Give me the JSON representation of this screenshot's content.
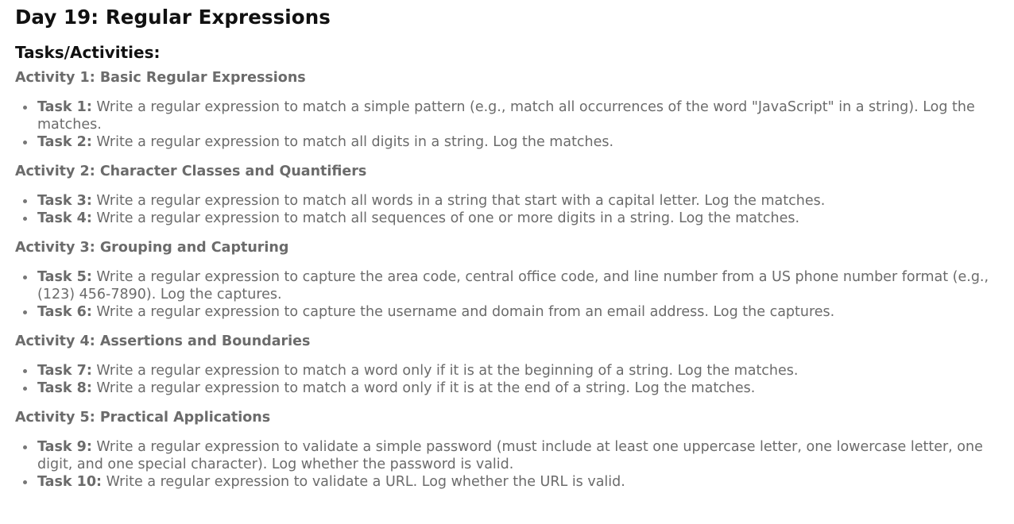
{
  "title": "Day 19: Regular Expressions",
  "subtitle": "Tasks/Activities:",
  "activities": [
    {
      "heading": "Activity 1: Basic Regular Expressions",
      "tasks": [
        {
          "label": "Task 1:",
          "text": " Write a regular expression to match a simple pattern (e.g., match all occurrences of the word \"JavaScript\" in a string). Log the matches."
        },
        {
          "label": "Task 2:",
          "text": " Write a regular expression to match all digits in a string. Log the matches."
        }
      ]
    },
    {
      "heading": "Activity 2: Character Classes and Quantifiers",
      "tasks": [
        {
          "label": "Task 3:",
          "text": " Write a regular expression to match all words in a string that start with a capital letter. Log the matches."
        },
        {
          "label": "Task 4:",
          "text": " Write a regular expression to match all sequences of one or more digits in a string. Log the matches."
        }
      ]
    },
    {
      "heading": "Activity 3: Grouping and Capturing",
      "tasks": [
        {
          "label": "Task 5:",
          "text": " Write a regular expression to capture the area code, central office code, and line number from a US phone number format (e.g., (123) 456-7890). Log the captures."
        },
        {
          "label": "Task 6:",
          "text": " Write a regular expression to capture the username and domain from an email address. Log the captures."
        }
      ]
    },
    {
      "heading": "Activity 4: Assertions and Boundaries",
      "tasks": [
        {
          "label": "Task 7:",
          "text": " Write a regular expression to match a word only if it is at the beginning of a string. Log the matches."
        },
        {
          "label": "Task 8:",
          "text": " Write a regular expression to match a word only if it is at the end of a string. Log the matches."
        }
      ]
    },
    {
      "heading": "Activity 5: Practical Applications",
      "tasks": [
        {
          "label": "Task 9:",
          "text": " Write a regular expression to validate a simple password (must include at least one uppercase letter, one lowercase letter, one digit, and one special character). Log whether the password is valid."
        },
        {
          "label": "Task 10:",
          "text": " Write a regular expression to validate a URL. Log whether the URL is valid."
        }
      ]
    }
  ]
}
